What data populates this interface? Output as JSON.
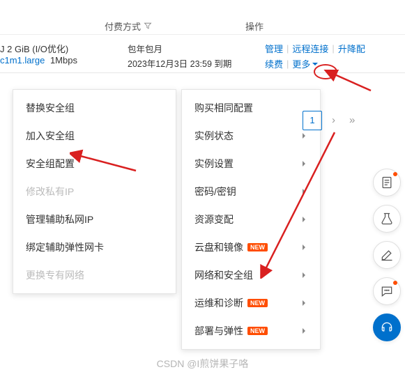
{
  "header": {
    "col_payment": "付费方式",
    "col_operation": "操作"
  },
  "instance": {
    "spec_prefix": "J 2 GiB  (I/O优化)",
    "spec_type": "c1m1.large",
    "bandwidth": "1Mbps",
    "paytype": "包年包月",
    "expire": "2023年12月3日 23:59 到期"
  },
  "actions": {
    "manage": "管理",
    "remote": "远程连接",
    "upgrade": "升降配",
    "renew": "续费",
    "more": "更多"
  },
  "submenu_left": [
    {
      "label": "替换安全组",
      "disabled": false
    },
    {
      "label": "加入安全组",
      "disabled": false
    },
    {
      "label": "安全组配置",
      "disabled": false
    },
    {
      "label": "修改私有IP",
      "disabled": true
    },
    {
      "label": "管理辅助私网IP",
      "disabled": false
    },
    {
      "label": "绑定辅助弹性网卡",
      "disabled": false
    },
    {
      "label": "更换专有网络",
      "disabled": true
    }
  ],
  "submenu_right": [
    {
      "label": "购买相同配置",
      "new": false,
      "sub": false
    },
    {
      "label": "实例状态",
      "new": false,
      "sub": true
    },
    {
      "label": "实例设置",
      "new": false,
      "sub": true
    },
    {
      "label": "密码/密钥",
      "new": false,
      "sub": true
    },
    {
      "label": "资源变配",
      "new": false,
      "sub": true
    },
    {
      "label": "云盘和镜像",
      "new": true,
      "sub": true
    },
    {
      "label": "网络和安全组",
      "new": false,
      "sub": true
    },
    {
      "label": "运维和诊断",
      "new": true,
      "sub": true
    },
    {
      "label": "部署与弹性",
      "new": true,
      "sub": true
    }
  ],
  "badge_text": "NEW",
  "pagination": {
    "current": "1"
  },
  "watermark": "CSDN @I煎饼果子咯"
}
